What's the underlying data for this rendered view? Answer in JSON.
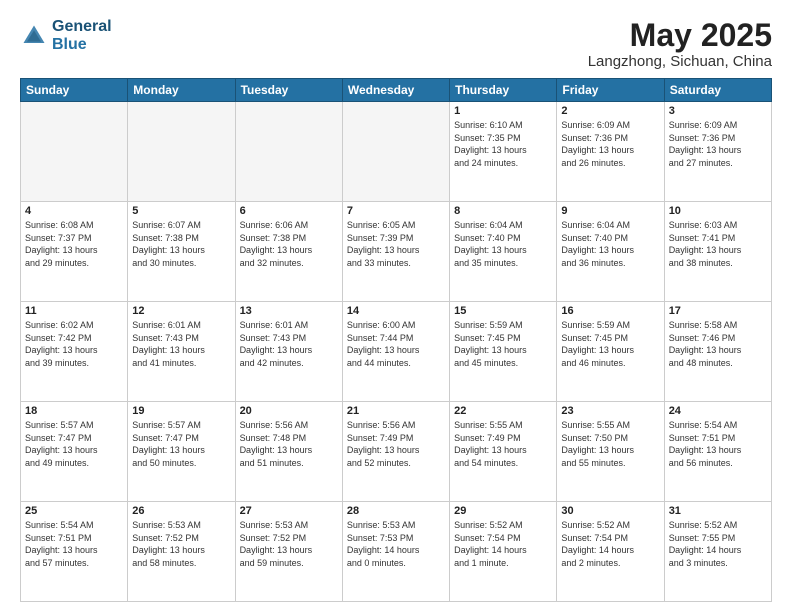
{
  "header": {
    "logo_line1": "General",
    "logo_line2": "Blue",
    "month": "May 2025",
    "location": "Langzhong, Sichuan, China"
  },
  "weekdays": [
    "Sunday",
    "Monday",
    "Tuesday",
    "Wednesday",
    "Thursday",
    "Friday",
    "Saturday"
  ],
  "weeks": [
    [
      {
        "day": "",
        "detail": "",
        "empty": true
      },
      {
        "day": "",
        "detail": "",
        "empty": true
      },
      {
        "day": "",
        "detail": "",
        "empty": true
      },
      {
        "day": "",
        "detail": "",
        "empty": true
      },
      {
        "day": "1",
        "detail": "Sunrise: 6:10 AM\nSunset: 7:35 PM\nDaylight: 13 hours\nand 24 minutes.",
        "empty": false
      },
      {
        "day": "2",
        "detail": "Sunrise: 6:09 AM\nSunset: 7:36 PM\nDaylight: 13 hours\nand 26 minutes.",
        "empty": false
      },
      {
        "day": "3",
        "detail": "Sunrise: 6:09 AM\nSunset: 7:36 PM\nDaylight: 13 hours\nand 27 minutes.",
        "empty": false
      }
    ],
    [
      {
        "day": "4",
        "detail": "Sunrise: 6:08 AM\nSunset: 7:37 PM\nDaylight: 13 hours\nand 29 minutes.",
        "empty": false
      },
      {
        "day": "5",
        "detail": "Sunrise: 6:07 AM\nSunset: 7:38 PM\nDaylight: 13 hours\nand 30 minutes.",
        "empty": false
      },
      {
        "day": "6",
        "detail": "Sunrise: 6:06 AM\nSunset: 7:38 PM\nDaylight: 13 hours\nand 32 minutes.",
        "empty": false
      },
      {
        "day": "7",
        "detail": "Sunrise: 6:05 AM\nSunset: 7:39 PM\nDaylight: 13 hours\nand 33 minutes.",
        "empty": false
      },
      {
        "day": "8",
        "detail": "Sunrise: 6:04 AM\nSunset: 7:40 PM\nDaylight: 13 hours\nand 35 minutes.",
        "empty": false
      },
      {
        "day": "9",
        "detail": "Sunrise: 6:04 AM\nSunset: 7:40 PM\nDaylight: 13 hours\nand 36 minutes.",
        "empty": false
      },
      {
        "day": "10",
        "detail": "Sunrise: 6:03 AM\nSunset: 7:41 PM\nDaylight: 13 hours\nand 38 minutes.",
        "empty": false
      }
    ],
    [
      {
        "day": "11",
        "detail": "Sunrise: 6:02 AM\nSunset: 7:42 PM\nDaylight: 13 hours\nand 39 minutes.",
        "empty": false
      },
      {
        "day": "12",
        "detail": "Sunrise: 6:01 AM\nSunset: 7:43 PM\nDaylight: 13 hours\nand 41 minutes.",
        "empty": false
      },
      {
        "day": "13",
        "detail": "Sunrise: 6:01 AM\nSunset: 7:43 PM\nDaylight: 13 hours\nand 42 minutes.",
        "empty": false
      },
      {
        "day": "14",
        "detail": "Sunrise: 6:00 AM\nSunset: 7:44 PM\nDaylight: 13 hours\nand 44 minutes.",
        "empty": false
      },
      {
        "day": "15",
        "detail": "Sunrise: 5:59 AM\nSunset: 7:45 PM\nDaylight: 13 hours\nand 45 minutes.",
        "empty": false
      },
      {
        "day": "16",
        "detail": "Sunrise: 5:59 AM\nSunset: 7:45 PM\nDaylight: 13 hours\nand 46 minutes.",
        "empty": false
      },
      {
        "day": "17",
        "detail": "Sunrise: 5:58 AM\nSunset: 7:46 PM\nDaylight: 13 hours\nand 48 minutes.",
        "empty": false
      }
    ],
    [
      {
        "day": "18",
        "detail": "Sunrise: 5:57 AM\nSunset: 7:47 PM\nDaylight: 13 hours\nand 49 minutes.",
        "empty": false
      },
      {
        "day": "19",
        "detail": "Sunrise: 5:57 AM\nSunset: 7:47 PM\nDaylight: 13 hours\nand 50 minutes.",
        "empty": false
      },
      {
        "day": "20",
        "detail": "Sunrise: 5:56 AM\nSunset: 7:48 PM\nDaylight: 13 hours\nand 51 minutes.",
        "empty": false
      },
      {
        "day": "21",
        "detail": "Sunrise: 5:56 AM\nSunset: 7:49 PM\nDaylight: 13 hours\nand 52 minutes.",
        "empty": false
      },
      {
        "day": "22",
        "detail": "Sunrise: 5:55 AM\nSunset: 7:49 PM\nDaylight: 13 hours\nand 54 minutes.",
        "empty": false
      },
      {
        "day": "23",
        "detail": "Sunrise: 5:55 AM\nSunset: 7:50 PM\nDaylight: 13 hours\nand 55 minutes.",
        "empty": false
      },
      {
        "day": "24",
        "detail": "Sunrise: 5:54 AM\nSunset: 7:51 PM\nDaylight: 13 hours\nand 56 minutes.",
        "empty": false
      }
    ],
    [
      {
        "day": "25",
        "detail": "Sunrise: 5:54 AM\nSunset: 7:51 PM\nDaylight: 13 hours\nand 57 minutes.",
        "empty": false
      },
      {
        "day": "26",
        "detail": "Sunrise: 5:53 AM\nSunset: 7:52 PM\nDaylight: 13 hours\nand 58 minutes.",
        "empty": false
      },
      {
        "day": "27",
        "detail": "Sunrise: 5:53 AM\nSunset: 7:52 PM\nDaylight: 13 hours\nand 59 minutes.",
        "empty": false
      },
      {
        "day": "28",
        "detail": "Sunrise: 5:53 AM\nSunset: 7:53 PM\nDaylight: 14 hours\nand 0 minutes.",
        "empty": false
      },
      {
        "day": "29",
        "detail": "Sunrise: 5:52 AM\nSunset: 7:54 PM\nDaylight: 14 hours\nand 1 minute.",
        "empty": false
      },
      {
        "day": "30",
        "detail": "Sunrise: 5:52 AM\nSunset: 7:54 PM\nDaylight: 14 hours\nand 2 minutes.",
        "empty": false
      },
      {
        "day": "31",
        "detail": "Sunrise: 5:52 AM\nSunset: 7:55 PM\nDaylight: 14 hours\nand 3 minutes.",
        "empty": false
      }
    ]
  ]
}
